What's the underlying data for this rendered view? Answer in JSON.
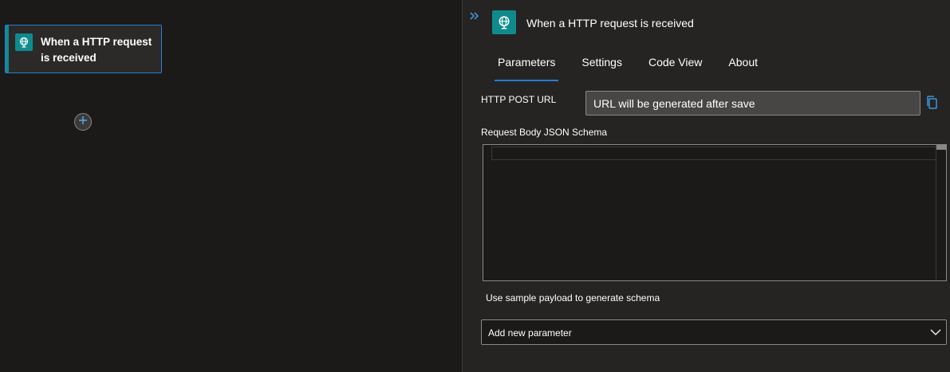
{
  "canvas": {
    "trigger_card": {
      "title": "When a HTTP request is received",
      "icon": "globe-icon"
    },
    "add_step": {
      "icon": "plus-icon"
    }
  },
  "panel": {
    "title": "When a HTTP request is received",
    "icon": "globe-icon",
    "collapse_icon": "double-chevron-right-icon",
    "tabs": [
      {
        "label": "Parameters",
        "active": true
      },
      {
        "label": "Settings"
      },
      {
        "label": "Code View"
      },
      {
        "label": "About"
      }
    ],
    "http_post_url": {
      "label": "HTTP POST URL",
      "value": "URL will be generated after save",
      "copy_icon": "copy-icon"
    },
    "schema": {
      "label": "Request Body JSON Schema",
      "value": ""
    },
    "sample_link": "Use sample payload to generate schema",
    "add_parameter": {
      "placeholder": "Add new parameter",
      "icon": "chevron-down-icon"
    }
  },
  "colors": {
    "accent": "#2a7bd6",
    "connector_teal": "#0f8b8d",
    "background": "#1b1a19",
    "panel": "#252423"
  }
}
